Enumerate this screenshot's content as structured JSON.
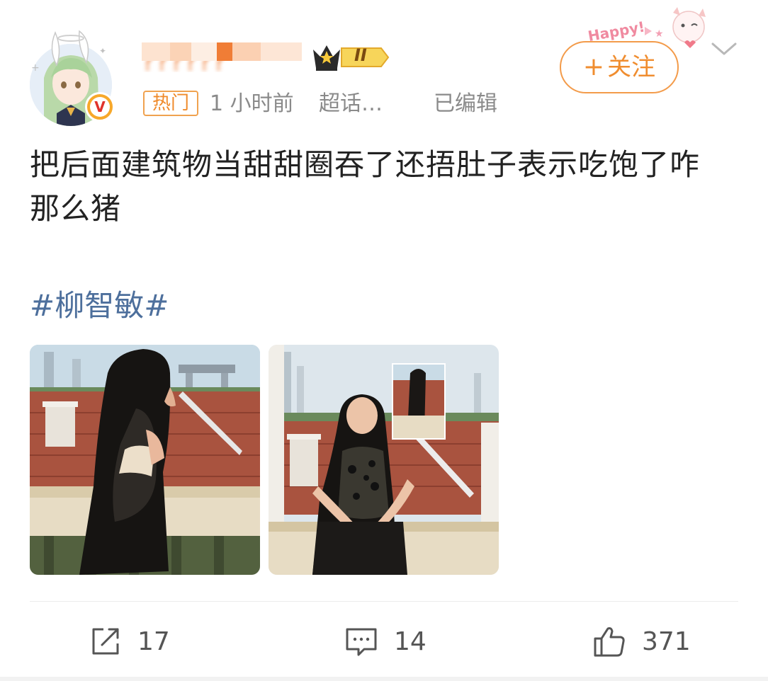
{
  "post": {
    "author": {
      "name": "??????",
      "verified_badge": "V",
      "level_badge": "II"
    },
    "hot_tag": "热门",
    "time": "1 小时前",
    "source": "超话…",
    "edited": "已编辑",
    "follow_label": "关注",
    "sticker_text": "Happy!",
    "text": "把后面建筑物当甜甜圈吞了还捂肚子表示吃饱了咋那么猪",
    "hashtag": "#柳智敏#",
    "images": [
      "photo-1",
      "photo-2"
    ]
  },
  "actions": {
    "repost_count": "17",
    "comment_count": "14",
    "like_count": "371"
  },
  "colors": {
    "accent_orange": "#f08d2f",
    "hashtag_blue": "#4d6f9c",
    "meta_gray": "#8a8a8a"
  },
  "icons": [
    "chevron-down-icon",
    "repost-icon",
    "comment-icon",
    "like-icon",
    "crown-icon",
    "verified-icon"
  ]
}
